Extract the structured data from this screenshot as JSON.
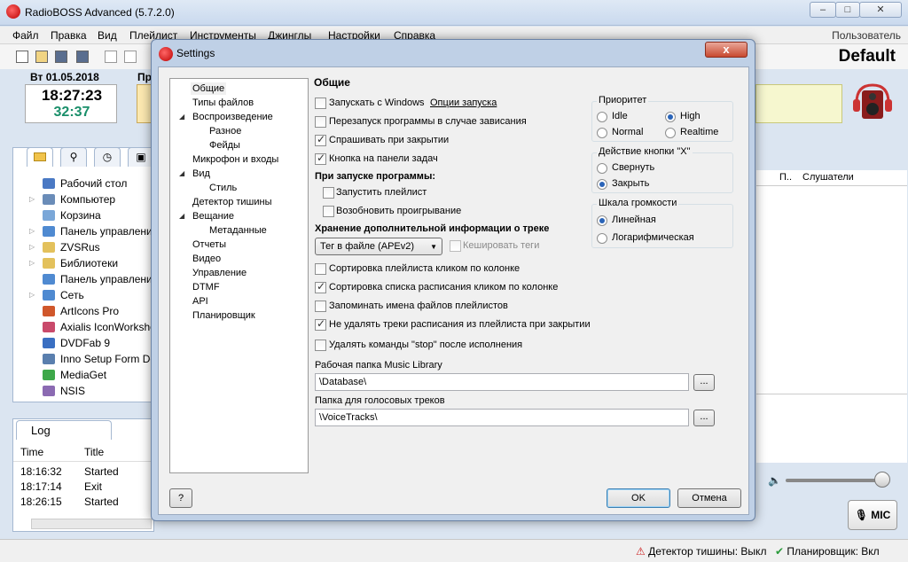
{
  "main": {
    "title": "RadioBOSS Advanced (5.7.2.0)",
    "menu": [
      "Файл",
      "Правка",
      "Вид",
      "Плейлист",
      "Инструменты",
      "Джинглы",
      "Настройки",
      "Справка"
    ],
    "user": "Пользователь",
    "profile": "Default",
    "date": "Вт 01.05.2018",
    "time": "18:27:23",
    "time_remaining": "32:37",
    "playlist_label_partial": "Пр",
    "right_columns": [
      "П..",
      "Слушатели"
    ],
    "mic_label": "MIC",
    "tree_items": [
      {
        "label": "Рабочий стол",
        "arrow": false,
        "color": "#4a79c4"
      },
      {
        "label": "Компьютер",
        "arrow": true,
        "color": "#6a8cb8"
      },
      {
        "label": "Корзина",
        "arrow": false,
        "color": "#7aa7d8"
      },
      {
        "label": "Панель управления",
        "arrow": true,
        "color": "#4f8ad1"
      },
      {
        "label": "ZVSRus",
        "arrow": true,
        "color": "#e3c15c"
      },
      {
        "label": "Библиотеки",
        "arrow": true,
        "color": "#e3c15c"
      },
      {
        "label": "Панель управления",
        "arrow": false,
        "color": "#4f8ad1"
      },
      {
        "label": "Сеть",
        "arrow": true,
        "color": "#4f8ad1"
      },
      {
        "label": "ArtIcons Pro",
        "arrow": false,
        "color": "#d0572b"
      },
      {
        "label": "Axialis IconWorkshop",
        "arrow": false,
        "color": "#c94a6b"
      },
      {
        "label": "DVDFab 9",
        "arrow": false,
        "color": "#3a6fc2"
      },
      {
        "label": "Inno Setup Form Desi",
        "arrow": false,
        "color": "#5a7fae"
      },
      {
        "label": "MediaGet",
        "arrow": false,
        "color": "#3ea84a"
      },
      {
        "label": "NSIS",
        "arrow": false,
        "color": "#8b6ab2"
      }
    ],
    "log": {
      "tab": "Log",
      "columns": [
        "Time",
        "Title"
      ],
      "rows": [
        {
          "time": "18:16:32",
          "title": "Started"
        },
        {
          "time": "18:17:14",
          "title": "Exit"
        },
        {
          "time": "18:26:15",
          "title": "Started"
        }
      ]
    },
    "status": {
      "silence": "Детектор тишины: Выкл",
      "scheduler": "Планировщик: Вкл"
    }
  },
  "dialog": {
    "title": "Settings",
    "close": "x",
    "nav": [
      {
        "label": "Общие",
        "indent": 0,
        "arrow": false,
        "selected": true
      },
      {
        "label": "Типы файлов",
        "indent": 0,
        "arrow": false
      },
      {
        "label": "Воспроизведение",
        "indent": 0,
        "arrow": true
      },
      {
        "label": "Разное",
        "indent": 1,
        "arrow": false
      },
      {
        "label": "Фейды",
        "indent": 1,
        "arrow": false
      },
      {
        "label": "Микрофон и входы",
        "indent": 0,
        "arrow": false
      },
      {
        "label": "Вид",
        "indent": 0,
        "arrow": true
      },
      {
        "label": "Стиль",
        "indent": 1,
        "arrow": false
      },
      {
        "label": "Детектор тишины",
        "indent": 0,
        "arrow": false
      },
      {
        "label": "Вещание",
        "indent": 0,
        "arrow": true
      },
      {
        "label": "Метаданные",
        "indent": 1,
        "arrow": false
      },
      {
        "label": "Отчеты",
        "indent": 0,
        "arrow": false
      },
      {
        "label": "Видео",
        "indent": 0,
        "arrow": false
      },
      {
        "label": "Управление",
        "indent": 0,
        "arrow": false
      },
      {
        "label": "DTMF",
        "indent": 0,
        "arrow": false
      },
      {
        "label": "API",
        "indent": 0,
        "arrow": false
      },
      {
        "label": "Планировщик",
        "indent": 0,
        "arrow": false
      }
    ],
    "heading": "Общие",
    "start_with_windows": "Запускать с Windows",
    "start_options_link": "Опции запуска",
    "restart_on_hang": "Перезапуск программы в случае зависания",
    "ask_on_close": "Спрашивать при закрытии",
    "taskbar_button": "Кнопка на панели задач",
    "on_start_title": "При запуске программы:",
    "start_playlist": "Запустить плейлист",
    "resume_playback": "Возобновить проигрывание",
    "storage_title": "Хранение дополнительной информации о треке",
    "storage_value": "Тег в файле (APEv2)",
    "cache_tags": "Кешировать теги",
    "sort_playlist": "Сортировка плейлиста кликом по колонке",
    "sort_schedule": "Сортировка списка расписания кликом по колонке",
    "remember_names": "Запоминать имена файлов плейлистов",
    "dont_delete": "Не удалять треки расписания из плейлиста при закрытии",
    "delete_stop": "Удалять команды \"stop\" после исполнения",
    "library_label": "Рабочая папка Music Library",
    "library_value": "\\Database\\",
    "voice_label": "Папка для голосовых треков",
    "voice_value": "\\VoiceTracks\\",
    "browse": "...",
    "priority": {
      "title": "Приоритет",
      "idle": "Idle",
      "high": "High",
      "normal": "Normal",
      "realtime": "Realtime"
    },
    "x_action": {
      "title": "Действие кнопки \"X\"",
      "minimize": "Свернуть",
      "close": "Закрыть"
    },
    "volume_scale": {
      "title": "Шкала громкости",
      "linear": "Линейная",
      "log": "Логарифмическая"
    },
    "help": "?",
    "ok": "OK",
    "cancel": "Отмена"
  }
}
